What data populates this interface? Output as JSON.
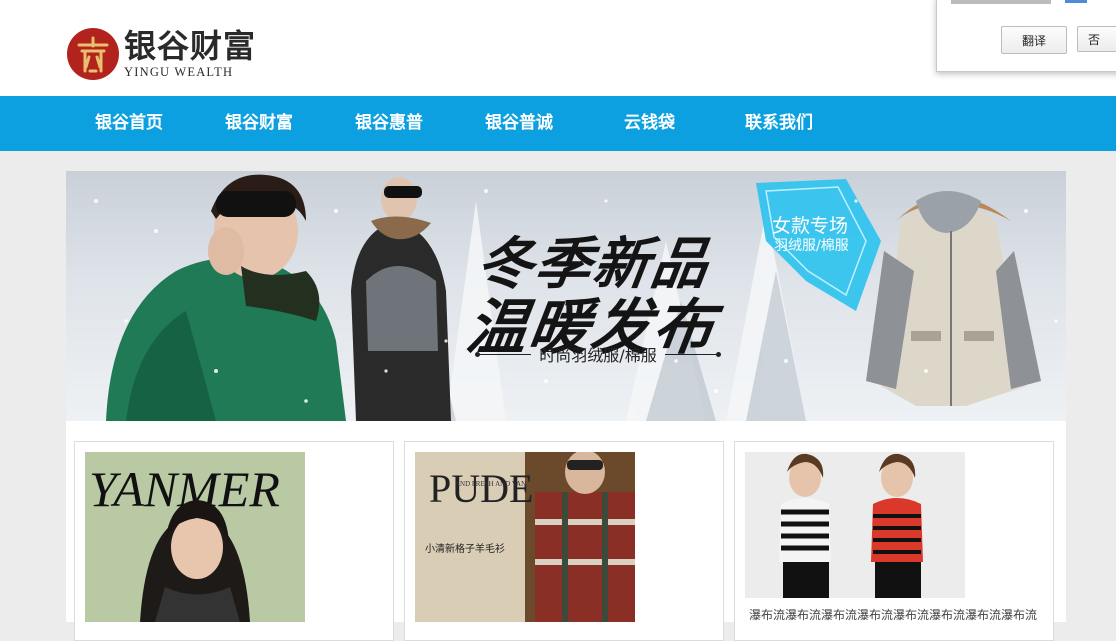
{
  "header": {
    "logo_cn": "银谷财富",
    "logo_en": "YINGU WEALTH"
  },
  "translate_popup": {
    "translate_label": "翻译",
    "no_label": "否"
  },
  "nav": {
    "items": [
      {
        "label": "银谷首页"
      },
      {
        "label": "银谷财富"
      },
      {
        "label": "银谷惠普"
      },
      {
        "label": "银谷普诚"
      },
      {
        "label": "云钱袋"
      },
      {
        "label": "联系我们"
      }
    ]
  },
  "banner": {
    "headline_line1": "冬季新品",
    "headline_line2": "温暖发布",
    "subline": "时尚羽绒服/棉服",
    "tag_title": "女款专场",
    "tag_sub": "羽绒服/棉服"
  },
  "products": [
    {
      "image_text": "YANMER",
      "caption": ""
    },
    {
      "image_text_big": "PUDE",
      "image_text_small": "AND FRESH AND VAN",
      "image_text_cn": "小清新格子羊毛衫",
      "caption": ""
    },
    {
      "caption": "瀑布流瀑布流瀑布流瀑布流瀑布流瀑布流瀑布流瀑布流"
    }
  ],
  "colors": {
    "nav_bg": "#0ca0e0",
    "page_bg": "#ececec",
    "logo_red": "#b3231d",
    "tag_blue": "#33c4ee"
  }
}
